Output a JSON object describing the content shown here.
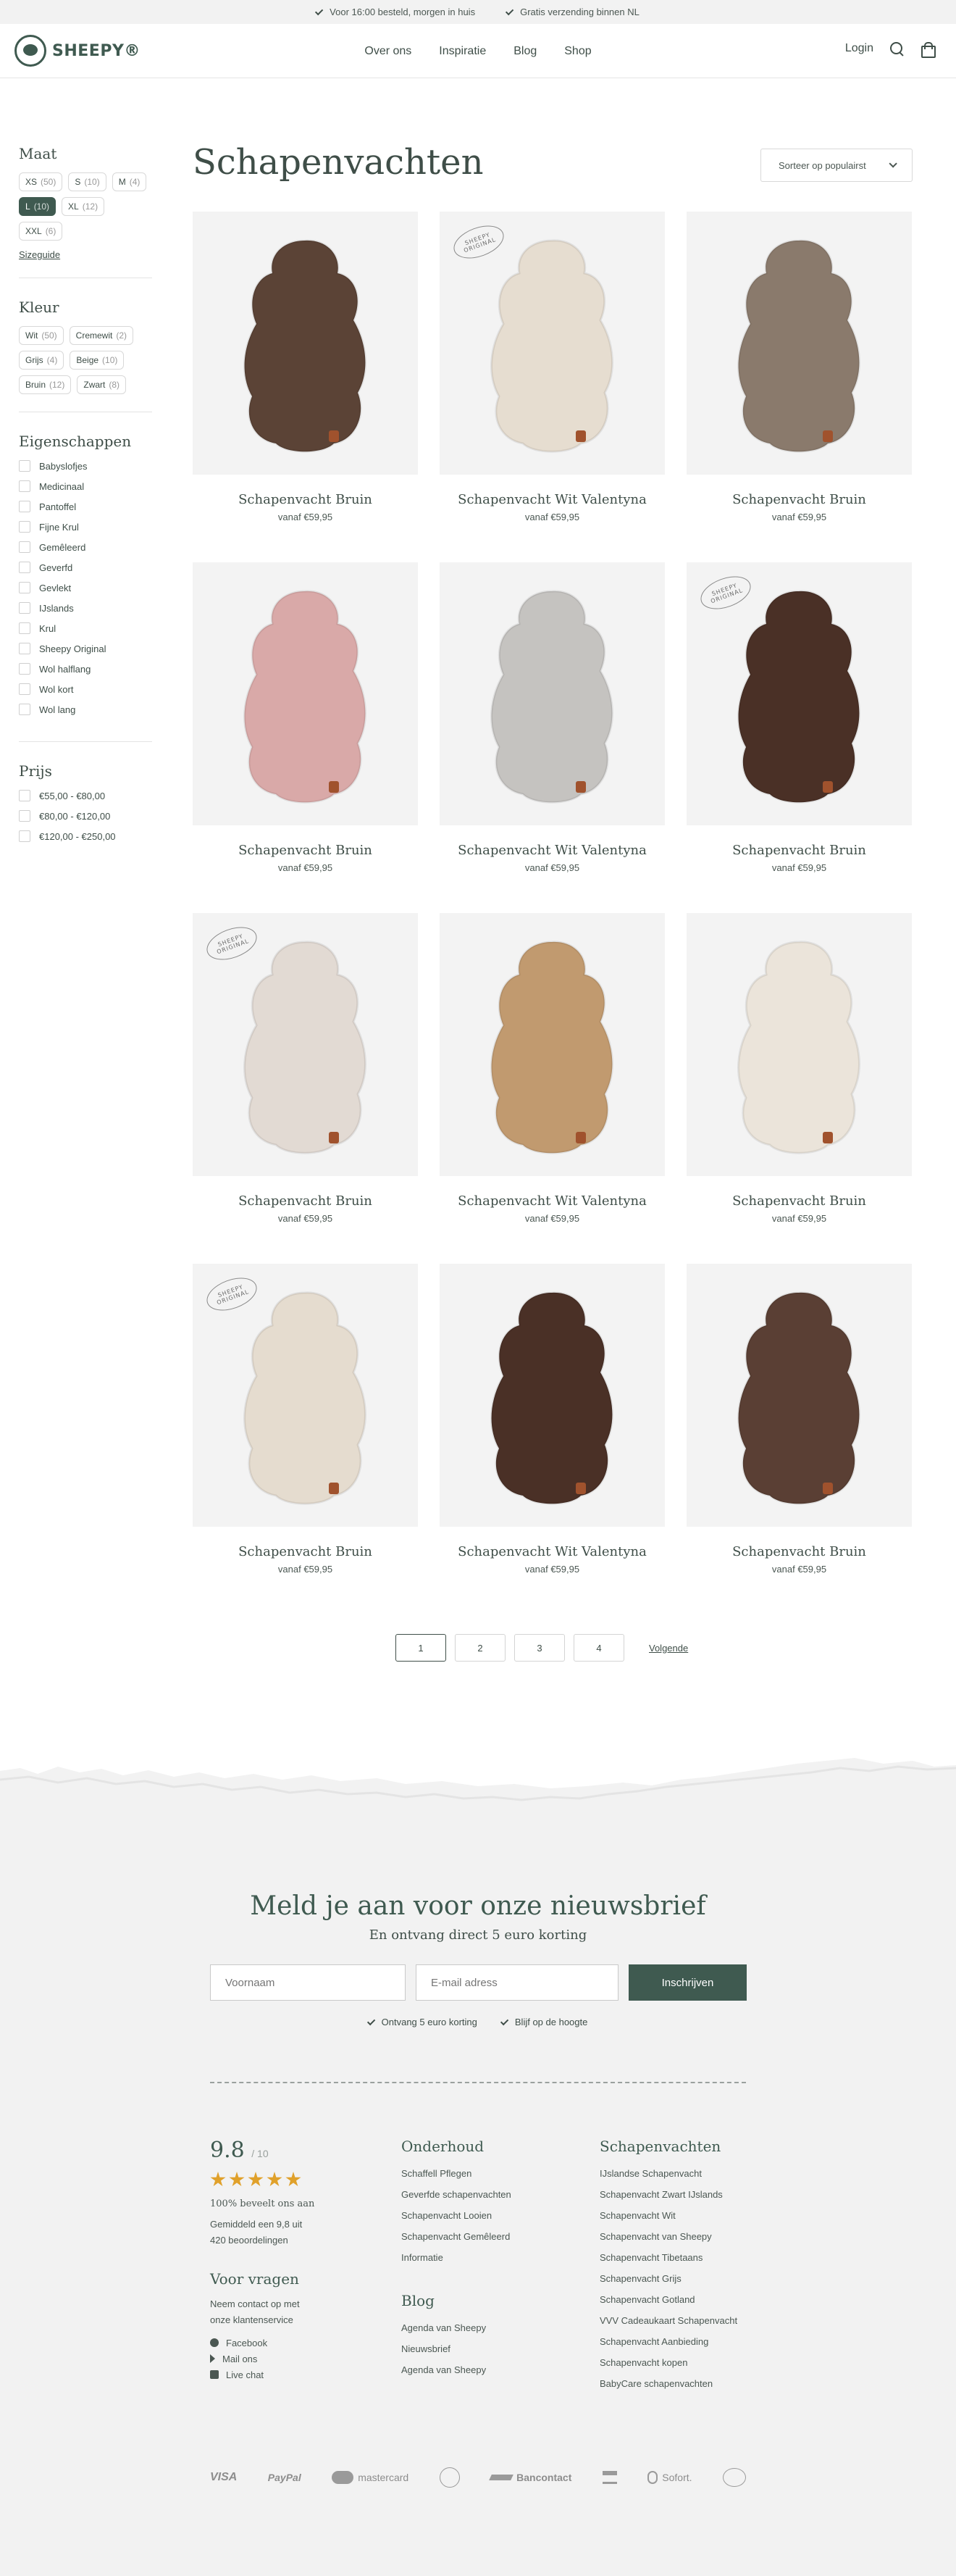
{
  "topbar": {
    "usp1": "Voor 16:00 besteld, morgen in huis",
    "usp2": "Gratis verzending binnen NL"
  },
  "header": {
    "logo": "SHEEPY®",
    "nav": [
      "Over ons",
      "Inspiratie",
      "Blog",
      "Shop"
    ],
    "login": "Login"
  },
  "filters": {
    "size": {
      "title": "Maat",
      "options": [
        {
          "label": "XS",
          "count": "(50)",
          "active": false
        },
        {
          "label": "S",
          "count": "(10)",
          "active": false
        },
        {
          "label": "M",
          "count": "(4)",
          "active": false
        },
        {
          "label": "L",
          "count": "(10)",
          "active": true
        },
        {
          "label": "XL",
          "count": "(12)",
          "active": false
        },
        {
          "label": "XXL",
          "count": "(6)",
          "active": false
        }
      ],
      "guide": "Sizeguide"
    },
    "color": {
      "title": "Kleur",
      "options": [
        {
          "label": "Wit",
          "count": "(50)"
        },
        {
          "label": "Cremewit",
          "count": "(2)"
        },
        {
          "label": "Grijs",
          "count": "(4)"
        },
        {
          "label": "Beige",
          "count": "(10)"
        },
        {
          "label": "Bruin",
          "count": "(12)"
        },
        {
          "label": "Zwart",
          "count": "(8)"
        }
      ]
    },
    "properties": {
      "title": "Eigenschappen",
      "options": [
        "Babyslofjes",
        "Medicinaal",
        "Pantoffel",
        "Fijne Krul",
        "Gemêleerd",
        "Geverfd",
        "Gevlekt",
        "IJslands",
        "Krul",
        "Sheepy Original",
        "Wol halflang",
        "Wol kort",
        "Wol lang"
      ]
    },
    "price": {
      "title": "Prijs",
      "options": [
        "€55,00 - €80,00",
        "€80,00 - €120,00",
        "€120,00 - €250,00"
      ]
    }
  },
  "main": {
    "title": "Schapenvachten",
    "sort": "Sorteer op populairst"
  },
  "products": [
    {
      "name": "Schapenvacht Bruin",
      "price": "vanaf €59,95",
      "color": "#5b4336",
      "badge": false
    },
    {
      "name": "Schapenvacht Wit Valentyna",
      "price": "vanaf €59,95",
      "color": "#e6ddd0",
      "badge": true
    },
    {
      "name": "Schapenvacht Bruin",
      "price": "vanaf €59,95",
      "color": "#8a7a6c",
      "badge": false
    },
    {
      "name": "Schapenvacht Bruin",
      "price": "vanaf €59,95",
      "color": "#d9a9a8",
      "badge": false
    },
    {
      "name": "Schapenvacht Wit Valentyna",
      "price": "vanaf €59,95",
      "color": "#c5c3c0",
      "badge": false
    },
    {
      "name": "Schapenvacht Bruin",
      "price": "vanaf €59,95",
      "color": "#4a3026",
      "badge": true
    },
    {
      "name": "Schapenvacht Bruin",
      "price": "vanaf €59,95",
      "color": "#e2dad3",
      "badge": true
    },
    {
      "name": "Schapenvacht Wit Valentyna",
      "price": "vanaf €59,95",
      "color": "#c19a6f",
      "badge": false
    },
    {
      "name": "Schapenvacht Bruin",
      "price": "vanaf €59,95",
      "color": "#ebe4da",
      "badge": false
    },
    {
      "name": "Schapenvacht Bruin",
      "price": "vanaf €59,95",
      "color": "#e5dccf",
      "badge": true
    },
    {
      "name": "Schapenvacht Wit Valentyna",
      "price": "vanaf €59,95",
      "color": "#4a3026",
      "badge": false
    },
    {
      "name": "Schapenvacht Bruin",
      "price": "vanaf €59,95",
      "color": "#5a3f34",
      "badge": false
    }
  ],
  "badge": {
    "line1": "SHEEPY",
    "line2": "ORIGINAL"
  },
  "pagination": {
    "pages": [
      "1",
      "2",
      "3",
      "4"
    ],
    "current": "1",
    "next": "Volgende"
  },
  "newsletter": {
    "title": "Meld je aan voor onze nieuwsbrief",
    "subtitle": "En ontvang direct 5 euro korting",
    "name_placeholder": "Voornaam",
    "email_placeholder": "E-mail adress",
    "button": "Inschrijven",
    "usp1": "Ontvang 5 euro korting",
    "usp2": "Blijf op de hoogte"
  },
  "footer": {
    "rating": {
      "score": "9.8",
      "of": "/ 10",
      "stars": 5,
      "recommend": "100% beveelt ons aan",
      "avg_line1": "Gemiddeld een 9,8 uit",
      "avg_line2": "420 beoordelingen"
    },
    "questions": {
      "title": "Voor vragen",
      "text_line1": "Neem contact op met",
      "text_line2": "onze klantenservice",
      "links": [
        "Facebook",
        "Mail ons",
        "Live chat"
      ]
    },
    "onderhoud": {
      "title": "Onderhoud",
      "links": [
        "Schaffell Pflegen",
        "Geverfde schapenvachten",
        "Schapenvacht Looien",
        "Schapenvacht Gemêleerd",
        "Informatie"
      ]
    },
    "blog": {
      "title": "Blog",
      "links": [
        "Agenda van Sheepy",
        "Nieuwsbrief",
        "Agenda van Sheepy"
      ]
    },
    "schapenvachten": {
      "title": "Schapenvachten",
      "links": [
        "IJslandse Schapenvacht",
        "Schapenvacht Zwart IJslands",
        "Schapenvacht Wit",
        "Schapenvacht van Sheepy",
        "Schapenvacht Tibetaans",
        "Schapenvacht Grijs",
        "Schapenvacht Gotland",
        "VVV Cadeaukaart Schapenvacht",
        "Schapenvacht Aanbieding",
        "Schapenvacht kopen",
        "BabyCare schapenvachten"
      ]
    },
    "payments": [
      "VISA",
      "PayPal",
      "mastercard",
      "",
      "Bancontact",
      "",
      "Sofort.",
      ""
    ]
  },
  "colors": {
    "accent": "#3f5a50",
    "footer_bg": "#f2f2f2",
    "star": "#e0a12b"
  }
}
